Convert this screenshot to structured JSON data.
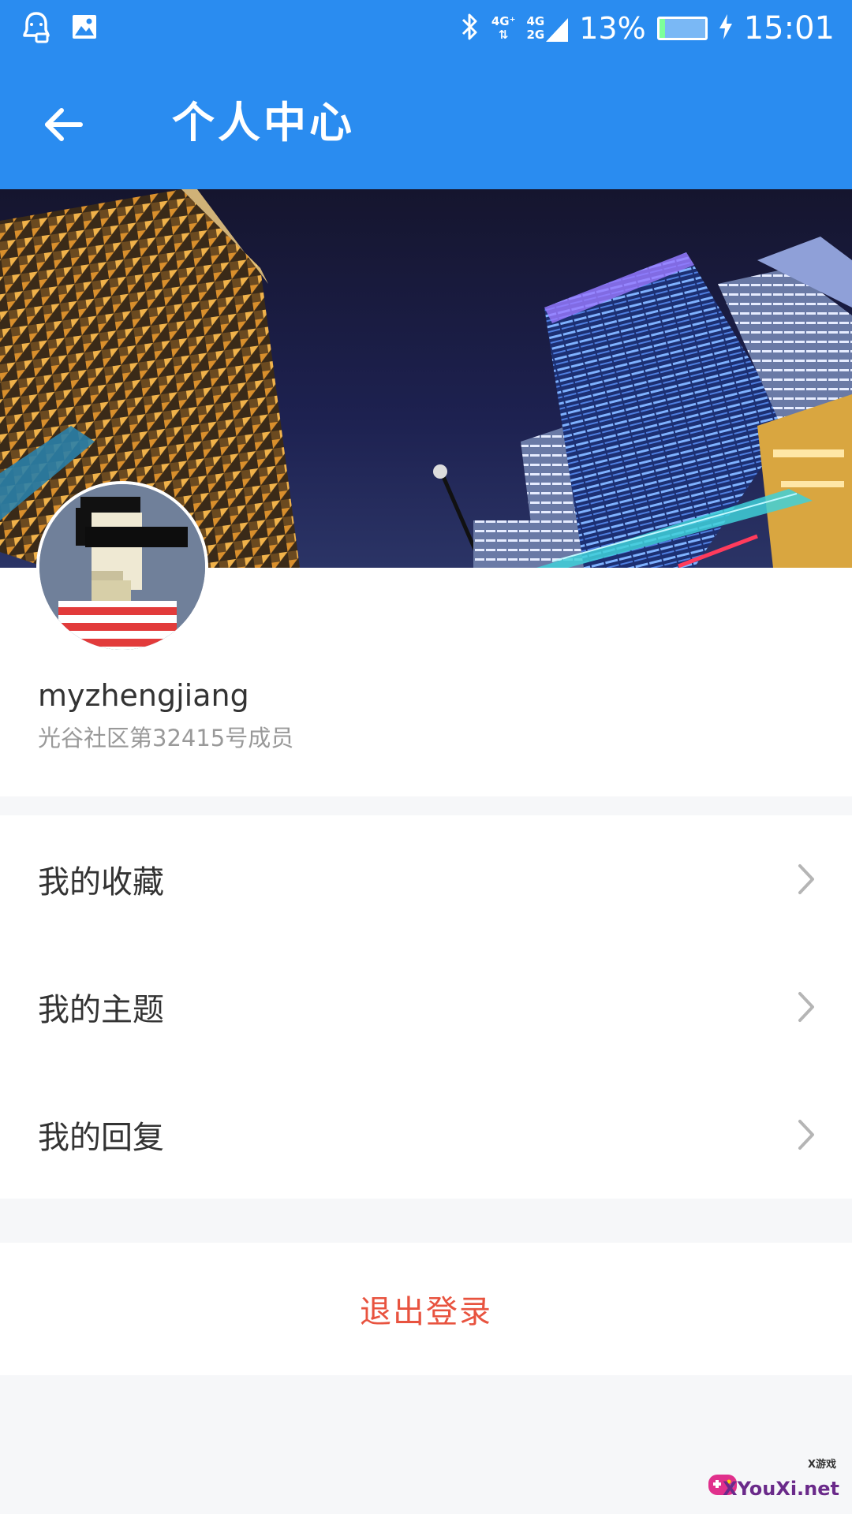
{
  "colors": {
    "primary": "#2a8cf0",
    "logout": "#e8533f",
    "text_primary": "#333333",
    "text_secondary": "#999999",
    "divider_bg": "#f6f7f9"
  },
  "status_bar": {
    "left_icons": [
      "app-notification-icon",
      "image-icon"
    ],
    "right_icons": [
      "bluetooth-icon",
      "signal-4g-icon",
      "signal-4g-2g-icon",
      "battery-icon",
      "charging-icon"
    ],
    "network_label_1_top": "4G⁺",
    "network_label_1_bottom": "⇅",
    "network_label_2_top": "4G",
    "network_label_2_bottom": "2G",
    "battery_percent": "13%",
    "battery_level": 0.13,
    "time": "15:01"
  },
  "toolbar": {
    "back_icon": "arrow-left-icon",
    "title": "个人中心"
  },
  "profile": {
    "avatar_icon": "pixel-avatar-sunglasses",
    "username": "myzhengjiang",
    "member_label": "光谷社区第32415号成员"
  },
  "menu": {
    "items": [
      {
        "label": "我的收藏",
        "icon": "chevron-right-icon"
      },
      {
        "label": "我的主题",
        "icon": "chevron-right-icon"
      },
      {
        "label": "我的回复",
        "icon": "chevron-right-icon"
      }
    ]
  },
  "logout": {
    "label": "退出登录"
  },
  "watermark": {
    "small": "X游戏",
    "main": "XYouXi.net"
  }
}
